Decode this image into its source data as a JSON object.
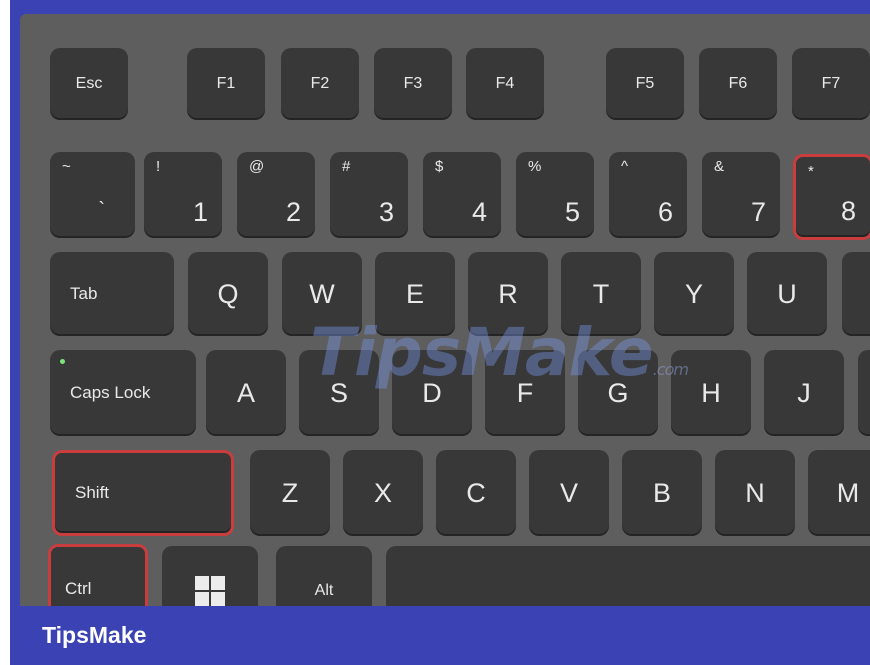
{
  "keyboard": {
    "function_row": [
      "Esc",
      "F1",
      "F2",
      "F3",
      "F4",
      "F5",
      "F6",
      "F7"
    ],
    "number_row": [
      {
        "top": "~",
        "bottom": "`"
      },
      {
        "top": "!",
        "bottom": "1"
      },
      {
        "top": "@",
        "bottom": "2"
      },
      {
        "top": "#",
        "bottom": "3"
      },
      {
        "top": "$",
        "bottom": "4"
      },
      {
        "top": "%",
        "bottom": "5"
      },
      {
        "top": "^",
        "bottom": "6"
      },
      {
        "top": "&",
        "bottom": "7"
      },
      {
        "top": "*",
        "bottom": "8"
      }
    ],
    "qwerty_row": [
      "Tab",
      "Q",
      "W",
      "E",
      "R",
      "T",
      "Y",
      "U"
    ],
    "home_row": [
      "Caps Lock",
      "A",
      "S",
      "D",
      "F",
      "G",
      "H",
      "J"
    ],
    "shift_row": [
      "Shift",
      "Z",
      "X",
      "C",
      "V",
      "B",
      "N",
      "M"
    ],
    "bottom_row": [
      "Ctrl",
      "",
      "Alt"
    ],
    "highlighted_keys": [
      "Ctrl",
      "Shift",
      "8"
    ],
    "highlight_color": "#c93d3f",
    "key_color": "#383838",
    "deck_color": "#5e5e5e"
  },
  "watermark": {
    "main": "TipsMake",
    "suffix": ".com"
  },
  "footer": {
    "brand": "TipsMake",
    "background": "#3a42b4"
  }
}
